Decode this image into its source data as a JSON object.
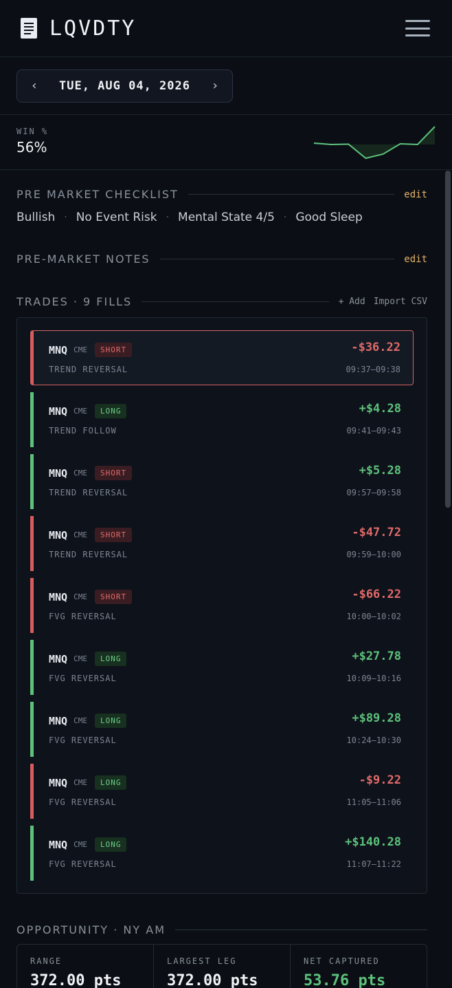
{
  "app": {
    "name": "LQVDTY"
  },
  "date_nav": {
    "prev": "‹",
    "date": "TUE, AUG 04, 2026",
    "next": "›"
  },
  "stats": {
    "win_label": "WIN %",
    "win_value": "56%",
    "sparkline_values": [
      0.4,
      0.2,
      0.25,
      -1.8,
      -1.2,
      0.3,
      0.2,
      2.8
    ],
    "sparkline_color": "#5dc17b"
  },
  "premarket_checklist": {
    "title": "PRE MARKET CHECKLIST",
    "edit": "edit",
    "items": [
      "Bullish",
      "No Event Risk",
      "Mental State 4/5",
      "Good Sleep"
    ],
    "separator": "·"
  },
  "premarket_notes": {
    "title": "PRE-MARKET NOTES",
    "edit": "edit"
  },
  "trades": {
    "title": "TRADES · 9 FILLS",
    "add": "+ Add",
    "import": "Import CSV",
    "items": [
      {
        "symbol": "MNQ",
        "exchange": "CME",
        "side": "SHORT",
        "setup": "TREND REVERSAL",
        "pnl": "-$36.22",
        "time": "09:37–09:38",
        "result": "loss",
        "selected": true
      },
      {
        "symbol": "MNQ",
        "exchange": "CME",
        "side": "LONG",
        "setup": "TREND FOLLOW",
        "pnl": "+$4.28",
        "time": "09:41–09:43",
        "result": "win"
      },
      {
        "symbol": "MNQ",
        "exchange": "CME",
        "side": "SHORT",
        "setup": "TREND REVERSAL",
        "pnl": "+$5.28",
        "time": "09:57–09:58",
        "result": "win"
      },
      {
        "symbol": "MNQ",
        "exchange": "CME",
        "side": "SHORT",
        "setup": "TREND REVERSAL",
        "pnl": "-$47.72",
        "time": "09:59–10:00",
        "result": "loss"
      },
      {
        "symbol": "MNQ",
        "exchange": "CME",
        "side": "SHORT",
        "setup": "FVG REVERSAL",
        "pnl": "-$66.22",
        "time": "10:00–10:02",
        "result": "loss"
      },
      {
        "symbol": "MNQ",
        "exchange": "CME",
        "side": "LONG",
        "setup": "FVG REVERSAL",
        "pnl": "+$27.78",
        "time": "10:09–10:16",
        "result": "win"
      },
      {
        "symbol": "MNQ",
        "exchange": "CME",
        "side": "LONG",
        "setup": "FVG REVERSAL",
        "pnl": "+$89.28",
        "time": "10:24–10:30",
        "result": "win"
      },
      {
        "symbol": "MNQ",
        "exchange": "CME",
        "side": "LONG",
        "setup": "FVG REVERSAL",
        "pnl": "-$9.22",
        "time": "11:05–11:06",
        "result": "loss"
      },
      {
        "symbol": "MNQ",
        "exchange": "CME",
        "side": "LONG",
        "setup": "FVG REVERSAL",
        "pnl": "+$140.28",
        "time": "11:07–11:22",
        "result": "win"
      }
    ]
  },
  "opportunity": {
    "title": "OPPORTUNITY · NY AM",
    "cells": [
      {
        "label": "RANGE",
        "value": "372.00 pts"
      },
      {
        "label": "LARGEST LEG",
        "value": "372.00 pts"
      },
      {
        "label": "NET CAPTURED",
        "value": "53.76 pts"
      }
    ]
  },
  "colors": {
    "win": "#5dc17b",
    "loss": "#d75d5d",
    "accent_edit": "#e5b267"
  }
}
